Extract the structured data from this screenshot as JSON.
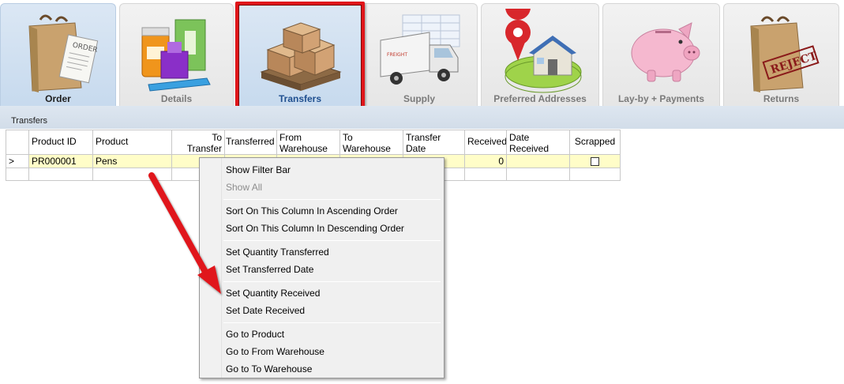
{
  "tabs": [
    {
      "label": "Order",
      "icon": "shopping-bag-order-icon"
    },
    {
      "label": "Details",
      "icon": "product-boxes-icon"
    },
    {
      "label": "Transfers",
      "icon": "pallet-boxes-icon"
    },
    {
      "label": "Supply",
      "icon": "delivery-truck-icon"
    },
    {
      "label": "Preferred Addresses",
      "icon": "house-location-pin-icon"
    },
    {
      "label": "Lay-by + Payments",
      "icon": "piggy-bank-icon"
    },
    {
      "label": "Returns",
      "icon": "rejected-bag-icon"
    }
  ],
  "active_tab": "Transfers",
  "section_caption": "Transfers",
  "grid": {
    "headers": {
      "product_id": "Product ID",
      "product": "Product",
      "to_transfer_1": "To",
      "to_transfer_2": "Transfer",
      "transferred": "Transferred",
      "from_wh_1": "From",
      "from_wh_2": "Warehouse",
      "to_wh_1": "To",
      "to_wh_2": "Warehouse",
      "transfer_date_1": "Transfer",
      "transfer_date_2": "Date",
      "received": "Received",
      "date_received_1": "Date",
      "date_received_2": "Received",
      "scrapped": "Scrapped"
    },
    "row": {
      "indicator": ">",
      "product_id": "PR000001",
      "product": "Pens",
      "received": "0"
    }
  },
  "context_menu": {
    "show_filter_bar": "Show Filter Bar",
    "show_all": "Show All",
    "sort_asc": "Sort On This Column In Ascending Order",
    "sort_desc": "Sort On This Column In Descending Order",
    "set_qty_transferred": "Set Quantity Transferred",
    "set_transferred_date": "Set Transferred Date",
    "set_qty_received": "Set Quantity Received",
    "set_date_received": "Set Date Received",
    "go_to_product": "Go to Product",
    "go_to_from_warehouse": "Go to From Warehouse",
    "go_to_to_warehouse": "Go to To Warehouse"
  },
  "colors": {
    "highlight_box": "#e0151a",
    "active_tab_label": "#1f4f8f",
    "selected_row": "#fffdc8",
    "group_bar": "#d6e0eb",
    "arrow": "#e0151a"
  }
}
